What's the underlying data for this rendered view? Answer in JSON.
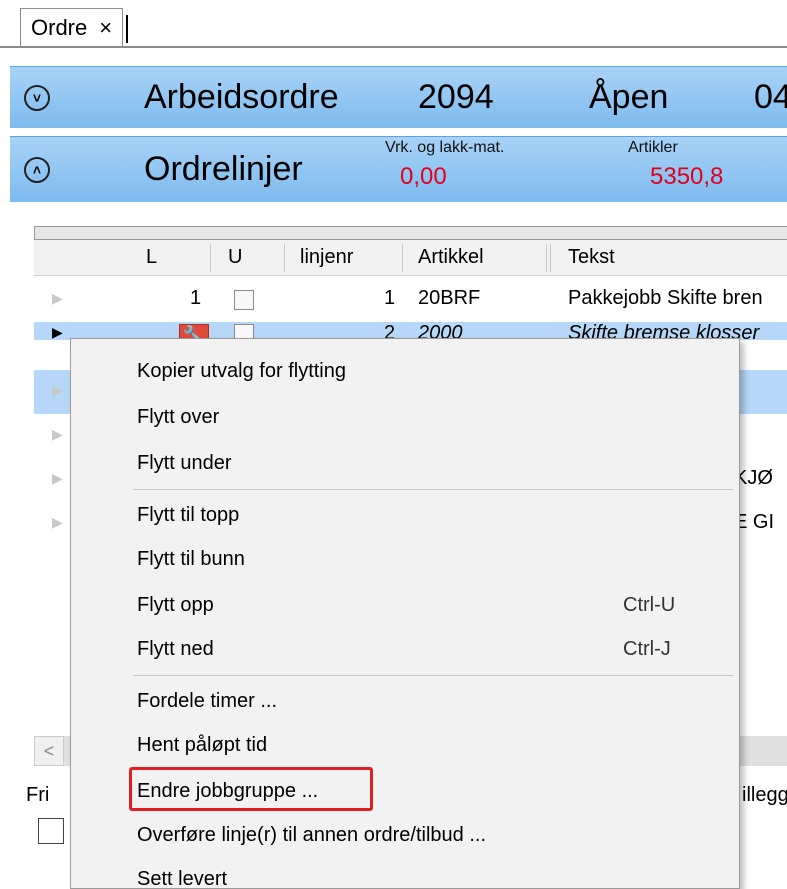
{
  "tab": {
    "label": "Ordre",
    "close": "×"
  },
  "workorder_bar": {
    "toggle": "˅",
    "title": "Arbeidsordre",
    "number": "2094",
    "status": "Åpen",
    "date_partial": "04"
  },
  "orderlines_bar": {
    "toggle": "˄",
    "title": "Ordrelinjer",
    "sum1_label": "Vrk. og lakk-mat.",
    "sum1_value": "0,00",
    "sum2_label": "Artikler",
    "sum2_value": "5350,8"
  },
  "grid": {
    "columns": [
      "L",
      "U",
      "linjenr",
      "Artikkel",
      "Tekst"
    ],
    "rows": [
      {
        "L": "1",
        "linjenr": "1",
        "artikkel": "20BRF",
        "tekst": "Pakkejobb Skifte bren"
      },
      {
        "L": "",
        "linjenr": "2",
        "artikkel": "2000",
        "tekst": "Skifte bremse klosser"
      }
    ],
    "partial_text_1": "KJØ",
    "partial_text_2": "E GI"
  },
  "bottom": {
    "scroll_left": "<",
    "fri_label": "Fri",
    "right_partial": "illegg"
  },
  "context_menu": {
    "items": [
      {
        "label": "Kopier utvalg for flytting",
        "shortcut": ""
      },
      {
        "label": "Flytt over",
        "shortcut": ""
      },
      {
        "label": "Flytt under",
        "shortcut": ""
      },
      {
        "label": "Flytt til topp",
        "shortcut": ""
      },
      {
        "label": "Flytt til bunn",
        "shortcut": ""
      },
      {
        "label": "Flytt opp",
        "shortcut": "Ctrl-U"
      },
      {
        "label": "Flytt ned",
        "shortcut": "Ctrl-J"
      },
      {
        "label": "Fordele timer ...",
        "shortcut": ""
      },
      {
        "label": "Hent påløpt tid",
        "shortcut": ""
      },
      {
        "label": "Endre jobbgruppe ...",
        "shortcut": ""
      },
      {
        "label": "Overføre linje(r) til annen ordre/tilbud ...",
        "shortcut": ""
      },
      {
        "label": "Sett levert",
        "shortcut": ""
      }
    ]
  },
  "colors": {
    "header_bar": "#8ec4f2",
    "sum_value": "#e2001a",
    "highlight": "#e02020",
    "selected_row": "#b6d7f7"
  }
}
